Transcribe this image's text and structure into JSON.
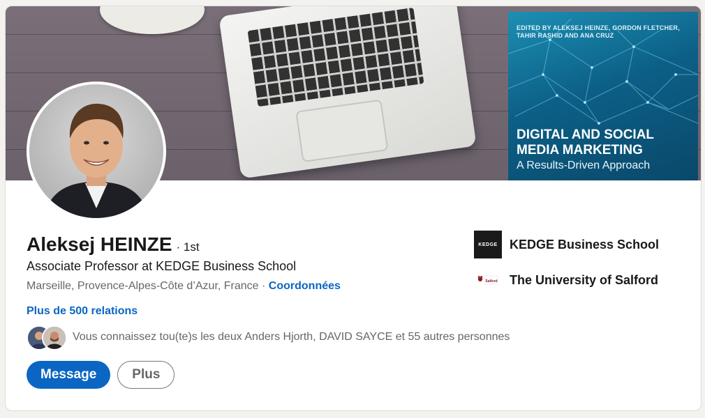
{
  "banner": {
    "book_editors": "EDITED BY ALEKSEJ HEINZE, GORDON FLETCHER, TAHIR RASHID AND ANA CRUZ",
    "book_title": "DIGITAL AND SOCIAL MEDIA MARKETING",
    "book_subtitle": "A Results-Driven Approach"
  },
  "profile": {
    "name": "Aleksej HEINZE",
    "degree": "· 1st",
    "headline": "Associate Professor at KEDGE Business School",
    "location": "Marseille, Provence-Alpes-Côte d’Azur, France",
    "location_separator": " · ",
    "contact_link": "Coordonnées",
    "connections": "Plus de 500 relations",
    "mutual_text": "Vous connaissez tou(te)s les deux Anders Hjorth, DAVID SAYCE et 55 autres personnes"
  },
  "actions": {
    "message_label": "Message",
    "more_label": "Plus"
  },
  "organizations": [
    {
      "name": "KEDGE Business School",
      "logo_text": "KEDGE"
    },
    {
      "name": "The University of Salford",
      "logo_text": "Salford"
    }
  ],
  "colors": {
    "accent": "#0a66c2",
    "text_primary": "#191919",
    "text_secondary": "#666666",
    "book_cover": "#0c5f86"
  }
}
